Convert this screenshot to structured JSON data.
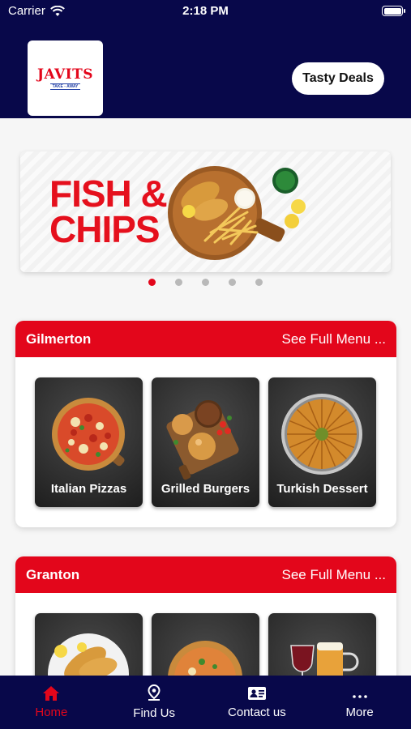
{
  "status_bar": {
    "carrier": "Carrier",
    "time": "2:18 PM"
  },
  "header": {
    "logo": {
      "name": "JAVITS",
      "tagline": "TAKE - AWAY"
    },
    "deals_button": "Tasty Deals",
    "background_color": "#08084a"
  },
  "banner": {
    "title_line1": "FISH &",
    "title_line2": "CHIPS",
    "carousel_total": 5,
    "carousel_active_index": 0
  },
  "locations": [
    {
      "name": "Gilmerton",
      "link": "See Full Menu ...",
      "categories": [
        {
          "label": "Italian Pizzas",
          "icon": "pizza-icon"
        },
        {
          "label": "Grilled Burgers",
          "icon": "burger-icon"
        },
        {
          "label": "Turkish Dessert",
          "icon": "baklava-icon"
        }
      ]
    },
    {
      "name": "Granton",
      "link": "See Full Menu ...",
      "categories": [
        {
          "label": "",
          "icon": "fish-icon"
        },
        {
          "label": "",
          "icon": "pizza-icon"
        },
        {
          "label": "",
          "icon": "drinks-icon"
        }
      ]
    }
  ],
  "tabbar": {
    "items": [
      {
        "label": "Home",
        "icon": "home-icon",
        "active": true
      },
      {
        "label": "Find Us",
        "icon": "location-pin-icon",
        "active": false
      },
      {
        "label": "Contact us",
        "icon": "contact-card-icon",
        "active": false
      },
      {
        "label": "More",
        "icon": "more-dots-icon",
        "active": false
      }
    ]
  },
  "colors": {
    "accent": "#e3061b",
    "navy": "#08084a",
    "background": "#f6f6f6"
  }
}
